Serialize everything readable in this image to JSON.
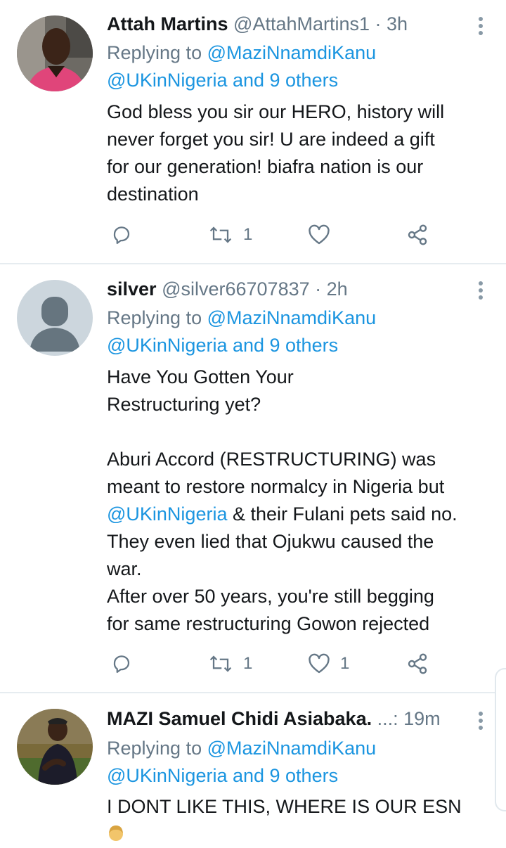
{
  "tweets": [
    {
      "name": "Attah Martins",
      "handle": "@AttahMartins1",
      "time": "3h",
      "replying_prefix": "Replying to",
      "replying_user": "@MaziNnamdiKanu",
      "replying_others": "@UKinNigeria and 9 others",
      "body_lines": [
        "God bless you sir our HERO, history will",
        "never forget you sir! U are indeed a gift",
        "for our generation! biafra nation is our",
        "destination"
      ],
      "retweets": "1",
      "likes": ""
    },
    {
      "name": "silver",
      "handle": "@silver66707837",
      "time": "2h",
      "replying_prefix": "Replying to",
      "replying_user": "@MaziNnamdiKanu",
      "replying_others": "@UKinNigeria and 9 others",
      "body_lines": [
        "Have You Gotten Your",
        "Restructuring yet?",
        "",
        "Aburi Accord (RESTRUCTURING) was",
        "meant to restore normalcy in Nigeria but",
        "& their Fulani pets said no.",
        "They even lied that Ojukwu caused the",
        "war.",
        "After over 50 years, you're still begging",
        "for same restructuring Gowon rejected"
      ],
      "mention_in_body": "@UKinNigeria",
      "retweets": "1",
      "likes": "1"
    },
    {
      "name": "MAZI Samuel Chidi Asiabaka.",
      "handle": "...:",
      "time": "19m",
      "replying_prefix": "Replying to",
      "replying_user": "@MaziNnamdiKanu",
      "replying_others": "@UKinNigeria and 9 others",
      "body_lines": [
        "I DONT LIKE THIS, WHERE IS OUR ESN"
      ]
    }
  ],
  "icons": {
    "reply": "reply-icon",
    "retweet": "retweet-icon",
    "like": "heart-icon",
    "share": "share-icon",
    "more": "more-vertical-icon",
    "emoji": "emoji-icon"
  },
  "colors": {
    "link": "#1b95e0",
    "muted": "#657786",
    "divider": "#e6ecf0"
  }
}
